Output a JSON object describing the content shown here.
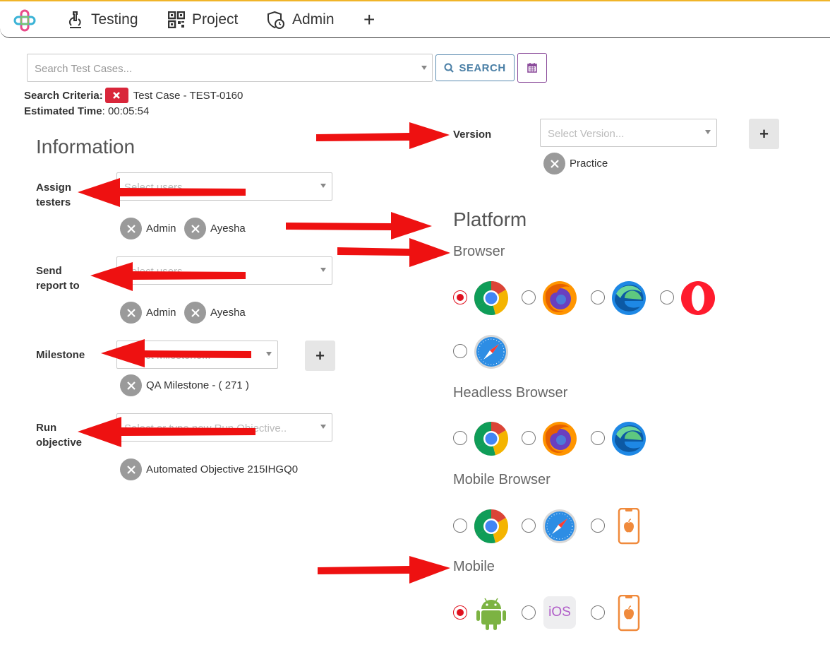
{
  "nav": {
    "items": [
      {
        "label": "Testing",
        "icon": "microscope-icon"
      },
      {
        "label": "Project",
        "icon": "qr-code-icon"
      },
      {
        "label": "Admin",
        "icon": "shield-clock-icon"
      }
    ],
    "add_symbol": "+"
  },
  "search": {
    "placeholder": "Search Test Cases...",
    "button_label": "SEARCH"
  },
  "criteria": {
    "label": "Search Criteria:",
    "value": "Test Case - TEST-0160",
    "est_label": "Estimated Time",
    "est_value": ": 00:05:54"
  },
  "information": {
    "title": "Information",
    "assign": {
      "label_line1": "Assign",
      "label_line2": "testers",
      "placeholder": "Select users...",
      "chips": [
        "Admin",
        "Ayesha"
      ]
    },
    "report": {
      "label_line1": "Send",
      "label_line2": "report to",
      "placeholder": "Select users...",
      "chips": [
        "Admin",
        "Ayesha"
      ]
    },
    "milestone": {
      "label": "Milestone",
      "placeholder": "Select Milestone...",
      "chip": "QA Milestone - ( 271 )",
      "add_symbol": "+"
    },
    "objective": {
      "label_line1": "Run",
      "label_line2": "objective",
      "placeholder": "Select or type new Run Objective..",
      "chip": "Automated Objective 215IHGQ0"
    }
  },
  "version": {
    "label": "Version",
    "placeholder": "Select Version...",
    "chip": "Practice",
    "add_symbol": "+"
  },
  "platform": {
    "title": "Platform",
    "browser_title": "Browser",
    "headless_title": "Headless Browser",
    "mobile_browser_title": "Mobile Browser",
    "mobile_title": "Mobile",
    "ios_label": "iOS"
  },
  "colors": {
    "accent_red": "#e0101e",
    "search_blue": "#4a7fa6",
    "calendar_purple": "#8a4a9a",
    "criteria_red": "#d9263a"
  }
}
